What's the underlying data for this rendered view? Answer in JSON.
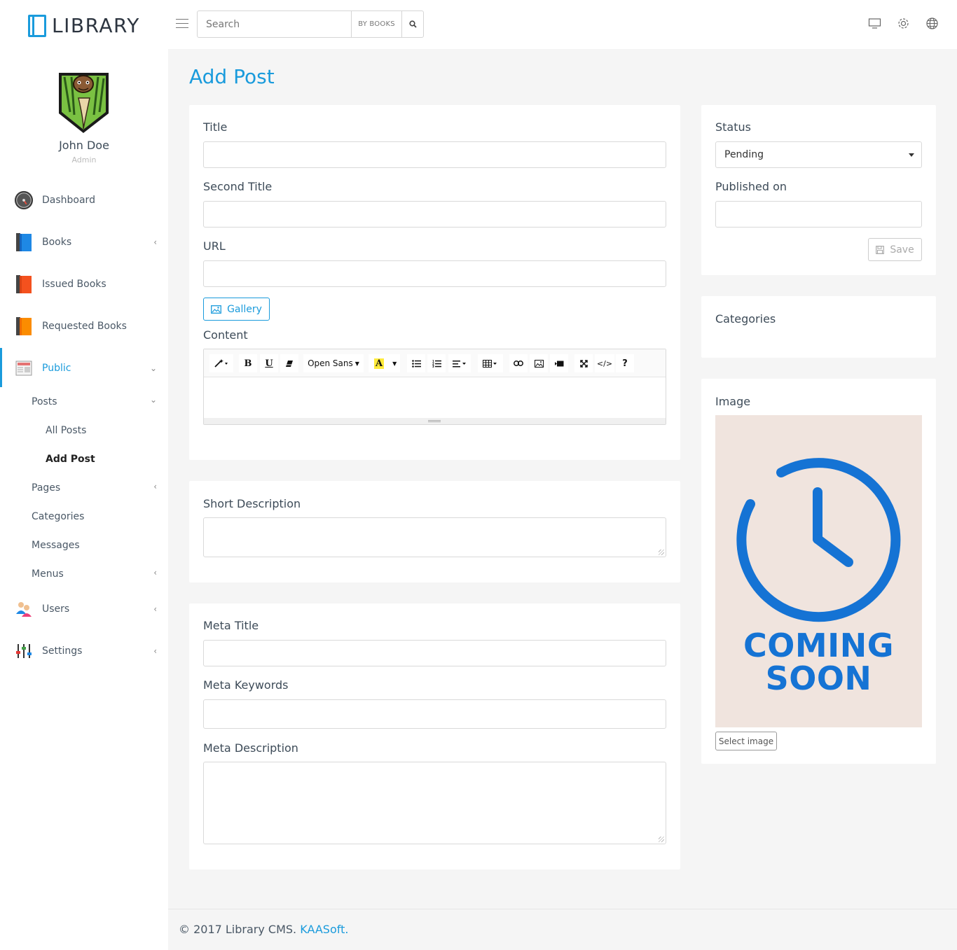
{
  "app": {
    "logo_text": "LIBRARY"
  },
  "header": {
    "search_placeholder": "Search",
    "search_scope": "BY BOOKS"
  },
  "user": {
    "name": "John Doe",
    "role": "Admin"
  },
  "sidebar": {
    "items": [
      {
        "label": "Dashboard"
      },
      {
        "label": "Books"
      },
      {
        "label": "Issued Books"
      },
      {
        "label": "Requested Books"
      },
      {
        "label": "Public"
      },
      {
        "label": "Users"
      },
      {
        "label": "Settings"
      }
    ],
    "public_sub": [
      {
        "label": "Posts"
      },
      {
        "label": "Pages"
      },
      {
        "label": "Categories"
      },
      {
        "label": "Messages"
      },
      {
        "label": "Menus"
      }
    ],
    "posts_sub": [
      {
        "label": "All Posts"
      },
      {
        "label": "Add Post"
      }
    ]
  },
  "page": {
    "title": "Add Post"
  },
  "form": {
    "title_label": "Title",
    "second_title_label": "Second Title",
    "url_label": "URL",
    "gallery_button": "Gallery",
    "content_label": "Content",
    "font_name": "Open Sans",
    "short_description_label": "Short Description",
    "meta_title_label": "Meta Title",
    "meta_keywords_label": "Meta Keywords",
    "meta_description_label": "Meta Description"
  },
  "side": {
    "status_label": "Status",
    "status_value": "Pending",
    "published_on_label": "Published on",
    "save_button": "Save",
    "categories_label": "Categories",
    "image_label": "Image",
    "coming_line1": "COMING",
    "coming_line2": "SOON",
    "select_image_button": "Select image"
  },
  "footer": {
    "text": "© 2017 Library CMS.",
    "link": "KAASoft."
  },
  "colors": {
    "accent": "#1a9bdc",
    "placeholder_blue": "#1573d4",
    "placeholder_bg": "#f0e4de"
  }
}
